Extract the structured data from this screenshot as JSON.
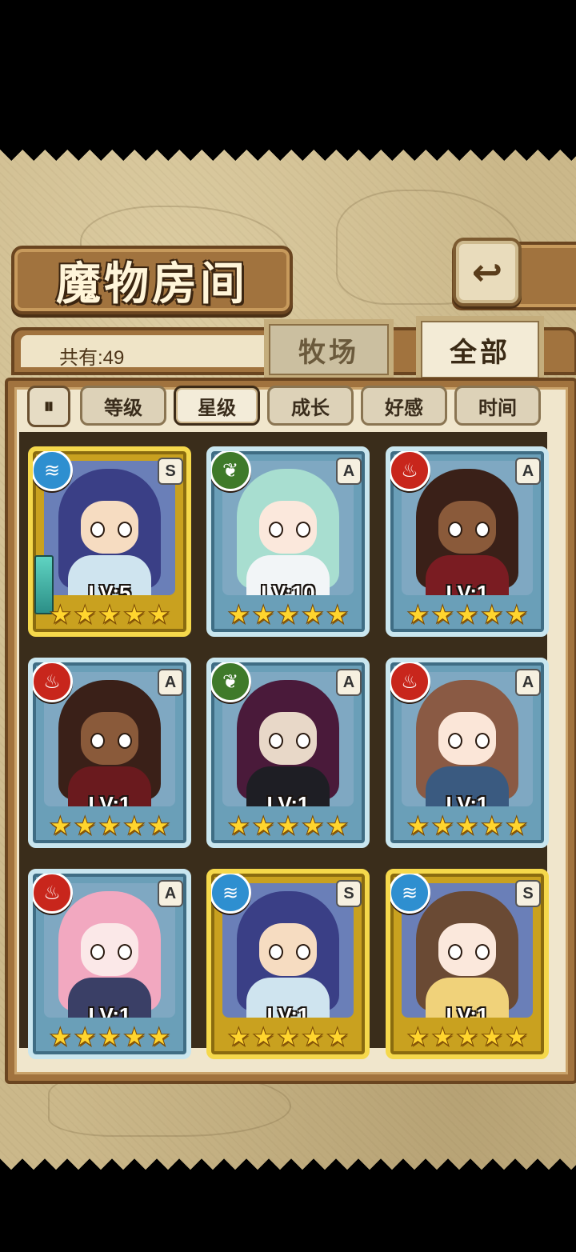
{
  "header": {
    "title": "魔物房间",
    "back_icon": "↩"
  },
  "summary": {
    "count_label": "共有:49"
  },
  "tabs": [
    {
      "label": "牧场",
      "active": false
    },
    {
      "label": "全部",
      "active": true
    }
  ],
  "sort": {
    "toggle_icon": "⏸",
    "options": [
      {
        "label": "等级",
        "active": false
      },
      {
        "label": "星级",
        "active": true
      },
      {
        "label": "成长",
        "active": false
      },
      {
        "label": "好感",
        "active": false
      },
      {
        "label": "时间",
        "active": false
      }
    ]
  },
  "monsters": [
    {
      "level": "LV:5",
      "element": "water",
      "element_icon": "≋",
      "rank": "S",
      "stars": 5,
      "frame": "gold",
      "hair": "#3a3f86",
      "skin": "#f6dcc1",
      "outfit": "#cfe4ef"
    },
    {
      "level": "LV:10",
      "element": "grass",
      "element_icon": "❦",
      "rank": "A",
      "stars": 5,
      "frame": "blue",
      "hair": "#a8ded0",
      "skin": "#fbe8dc",
      "outfit": "#f2f5f7"
    },
    {
      "level": "LV:1",
      "element": "fire",
      "element_icon": "♨",
      "rank": "A",
      "stars": 5,
      "frame": "blue",
      "hair": "#3a2018",
      "skin": "#8a5a3a",
      "outfit": "#7a1c22"
    },
    {
      "level": "LV:1",
      "element": "fire",
      "element_icon": "♨",
      "rank": "A",
      "stars": 5,
      "frame": "blue",
      "hair": "#3a2018",
      "skin": "#8a5a3a",
      "outfit": "#6a1a1e"
    },
    {
      "level": "LV:1",
      "element": "grass",
      "element_icon": "❦",
      "rank": "A",
      "stars": 5,
      "frame": "blue",
      "hair": "#4a1a3a",
      "skin": "#e8d8c8",
      "outfit": "#1e1e24"
    },
    {
      "level": "LV:1",
      "element": "fire",
      "element_icon": "♨",
      "rank": "A",
      "stars": 5,
      "frame": "blue",
      "hair": "#8a5a44",
      "skin": "#fbe6d8",
      "outfit": "#3a5a80"
    },
    {
      "level": "LV:1",
      "element": "fire",
      "element_icon": "♨",
      "rank": "A",
      "stars": 5,
      "frame": "blue",
      "hair": "#f2a8c0",
      "skin": "#fbe8e8",
      "outfit": "#3a3f66"
    },
    {
      "level": "LV:1",
      "element": "water",
      "element_icon": "≋",
      "rank": "S",
      "stars": 5,
      "frame": "gold",
      "hair": "#3a3f86",
      "skin": "#f6dcc1",
      "outfit": "#cfe4ef"
    },
    {
      "level": "LV:1",
      "element": "water",
      "element_icon": "≋",
      "rank": "S",
      "stars": 5,
      "frame": "gold",
      "hair": "#6a4a34",
      "skin": "#fbe8dc",
      "outfit": "#f0d27a"
    }
  ]
}
